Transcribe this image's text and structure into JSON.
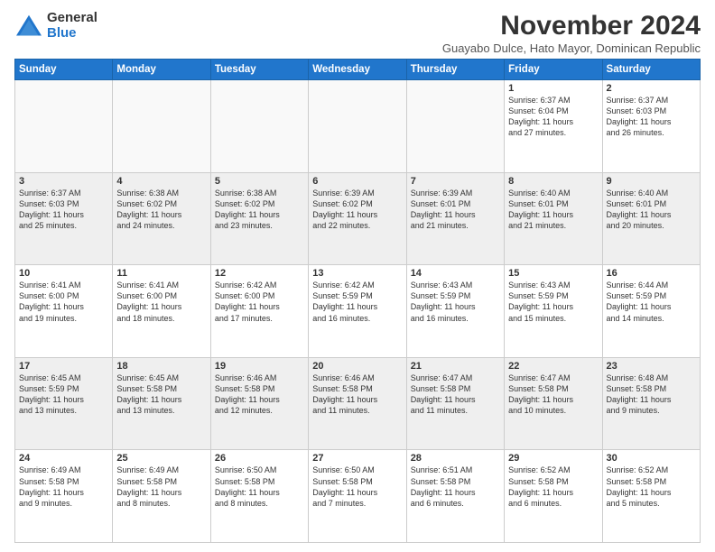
{
  "logo": {
    "general": "General",
    "blue": "Blue"
  },
  "title": "November 2024",
  "subtitle": "Guayabo Dulce, Hato Mayor, Dominican Republic",
  "days_of_week": [
    "Sunday",
    "Monday",
    "Tuesday",
    "Wednesday",
    "Thursday",
    "Friday",
    "Saturday"
  ],
  "weeks": [
    [
      {
        "day": "",
        "info": ""
      },
      {
        "day": "",
        "info": ""
      },
      {
        "day": "",
        "info": ""
      },
      {
        "day": "",
        "info": ""
      },
      {
        "day": "",
        "info": ""
      },
      {
        "day": "1",
        "info": "Sunrise: 6:37 AM\nSunset: 6:04 PM\nDaylight: 11 hours\nand 27 minutes."
      },
      {
        "day": "2",
        "info": "Sunrise: 6:37 AM\nSunset: 6:03 PM\nDaylight: 11 hours\nand 26 minutes."
      }
    ],
    [
      {
        "day": "3",
        "info": "Sunrise: 6:37 AM\nSunset: 6:03 PM\nDaylight: 11 hours\nand 25 minutes."
      },
      {
        "day": "4",
        "info": "Sunrise: 6:38 AM\nSunset: 6:02 PM\nDaylight: 11 hours\nand 24 minutes."
      },
      {
        "day": "5",
        "info": "Sunrise: 6:38 AM\nSunset: 6:02 PM\nDaylight: 11 hours\nand 23 minutes."
      },
      {
        "day": "6",
        "info": "Sunrise: 6:39 AM\nSunset: 6:02 PM\nDaylight: 11 hours\nand 22 minutes."
      },
      {
        "day": "7",
        "info": "Sunrise: 6:39 AM\nSunset: 6:01 PM\nDaylight: 11 hours\nand 21 minutes."
      },
      {
        "day": "8",
        "info": "Sunrise: 6:40 AM\nSunset: 6:01 PM\nDaylight: 11 hours\nand 21 minutes."
      },
      {
        "day": "9",
        "info": "Sunrise: 6:40 AM\nSunset: 6:01 PM\nDaylight: 11 hours\nand 20 minutes."
      }
    ],
    [
      {
        "day": "10",
        "info": "Sunrise: 6:41 AM\nSunset: 6:00 PM\nDaylight: 11 hours\nand 19 minutes."
      },
      {
        "day": "11",
        "info": "Sunrise: 6:41 AM\nSunset: 6:00 PM\nDaylight: 11 hours\nand 18 minutes."
      },
      {
        "day": "12",
        "info": "Sunrise: 6:42 AM\nSunset: 6:00 PM\nDaylight: 11 hours\nand 17 minutes."
      },
      {
        "day": "13",
        "info": "Sunrise: 6:42 AM\nSunset: 5:59 PM\nDaylight: 11 hours\nand 16 minutes."
      },
      {
        "day": "14",
        "info": "Sunrise: 6:43 AM\nSunset: 5:59 PM\nDaylight: 11 hours\nand 16 minutes."
      },
      {
        "day": "15",
        "info": "Sunrise: 6:43 AM\nSunset: 5:59 PM\nDaylight: 11 hours\nand 15 minutes."
      },
      {
        "day": "16",
        "info": "Sunrise: 6:44 AM\nSunset: 5:59 PM\nDaylight: 11 hours\nand 14 minutes."
      }
    ],
    [
      {
        "day": "17",
        "info": "Sunrise: 6:45 AM\nSunset: 5:59 PM\nDaylight: 11 hours\nand 13 minutes."
      },
      {
        "day": "18",
        "info": "Sunrise: 6:45 AM\nSunset: 5:58 PM\nDaylight: 11 hours\nand 13 minutes."
      },
      {
        "day": "19",
        "info": "Sunrise: 6:46 AM\nSunset: 5:58 PM\nDaylight: 11 hours\nand 12 minutes."
      },
      {
        "day": "20",
        "info": "Sunrise: 6:46 AM\nSunset: 5:58 PM\nDaylight: 11 hours\nand 11 minutes."
      },
      {
        "day": "21",
        "info": "Sunrise: 6:47 AM\nSunset: 5:58 PM\nDaylight: 11 hours\nand 11 minutes."
      },
      {
        "day": "22",
        "info": "Sunrise: 6:47 AM\nSunset: 5:58 PM\nDaylight: 11 hours\nand 10 minutes."
      },
      {
        "day": "23",
        "info": "Sunrise: 6:48 AM\nSunset: 5:58 PM\nDaylight: 11 hours\nand 9 minutes."
      }
    ],
    [
      {
        "day": "24",
        "info": "Sunrise: 6:49 AM\nSunset: 5:58 PM\nDaylight: 11 hours\nand 9 minutes."
      },
      {
        "day": "25",
        "info": "Sunrise: 6:49 AM\nSunset: 5:58 PM\nDaylight: 11 hours\nand 8 minutes."
      },
      {
        "day": "26",
        "info": "Sunrise: 6:50 AM\nSunset: 5:58 PM\nDaylight: 11 hours\nand 8 minutes."
      },
      {
        "day": "27",
        "info": "Sunrise: 6:50 AM\nSunset: 5:58 PM\nDaylight: 11 hours\nand 7 minutes."
      },
      {
        "day": "28",
        "info": "Sunrise: 6:51 AM\nSunset: 5:58 PM\nDaylight: 11 hours\nand 6 minutes."
      },
      {
        "day": "29",
        "info": "Sunrise: 6:52 AM\nSunset: 5:58 PM\nDaylight: 11 hours\nand 6 minutes."
      },
      {
        "day": "30",
        "info": "Sunrise: 6:52 AM\nSunset: 5:58 PM\nDaylight: 11 hours\nand 5 minutes."
      }
    ]
  ]
}
